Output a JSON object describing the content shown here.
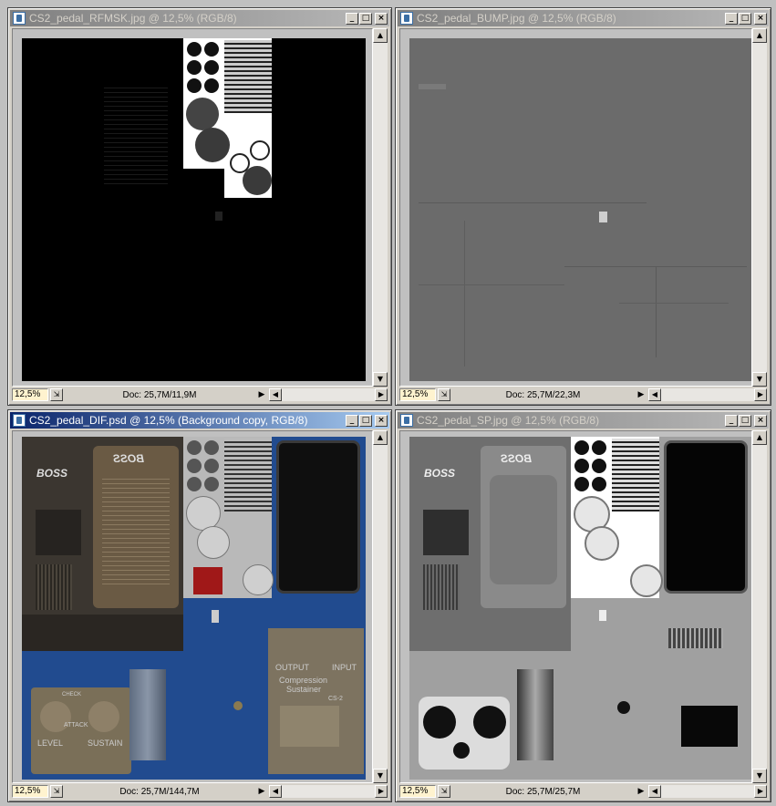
{
  "windows": [
    {
      "title": "CS2_pedal_RFMSK.jpg @ 12,5% (RGB/8)",
      "zoom": "12,5%",
      "doc": "Doc: 25,7M/11,9M",
      "active": false
    },
    {
      "title": "CS2_pedal_BUMP.jpg @ 12,5% (RGB/8)",
      "zoom": "12,5%",
      "doc": "Doc: 25,7M/22,3M",
      "active": false
    },
    {
      "title": "CS2_pedal_DIF.psd @ 12,5% (Background copy, RGB/8)",
      "zoom": "12,5%",
      "doc": "Doc: 25,7M/144,7M",
      "active": true
    },
    {
      "title": "CS2_pedal_SP.jpg @ 12,5% (RGB/8)",
      "zoom": "12,5%",
      "doc": "Doc: 25,7M/25,7M",
      "active": false
    }
  ],
  "texture_text": {
    "boss": "BOSS",
    "boss_mirrored": "BOSS",
    "compression": "Compression",
    "sustainer": "Sustainer",
    "model": "CS-2",
    "output": "OUTPUT",
    "input": "INPUT",
    "level": "LEVEL",
    "attack": "ATTACK",
    "sustain": "SUSTAIN",
    "check": "CHECK"
  },
  "icons": {
    "app": "photoshop-doc-icon",
    "minimize": "minimize-icon",
    "maximize": "maximize-icon",
    "close": "close-icon",
    "scroll_up": "scroll-up-icon",
    "scroll_down": "scroll-down-icon",
    "scroll_left": "scroll-left-icon",
    "scroll_right": "scroll-right-icon",
    "status_menu": "status-menu-arrow-icon"
  }
}
